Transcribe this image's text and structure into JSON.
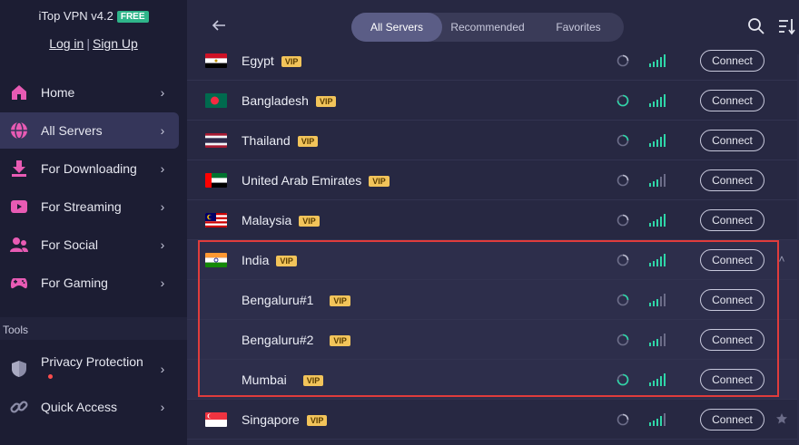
{
  "app": {
    "title": "iTop VPN v4.2",
    "badge": "FREE"
  },
  "auth": {
    "login": "Log in",
    "separator": "|",
    "signup": "Sign Up"
  },
  "sidebar": {
    "items": [
      {
        "label": "Home",
        "icon": "home-icon"
      },
      {
        "label": "All Servers",
        "icon": "globe-icon",
        "active": true
      },
      {
        "label": "For Downloading",
        "icon": "download-icon"
      },
      {
        "label": "For Streaming",
        "icon": "play-icon"
      },
      {
        "label": "For Social",
        "icon": "people-icon"
      },
      {
        "label": "For Gaming",
        "icon": "gamepad-icon"
      }
    ],
    "tools_label": "Tools",
    "tools": [
      {
        "label": "Privacy Protection",
        "icon": "shield-icon",
        "dot": true
      },
      {
        "label": "Quick Access",
        "icon": "link-icon"
      }
    ]
  },
  "tabs": [
    {
      "label": "All Servers",
      "active": true
    },
    {
      "label": "Recommended"
    },
    {
      "label": "Favorites"
    }
  ],
  "servers": [
    {
      "name": "Egypt",
      "vip": "VIP",
      "connect": "Connect",
      "signal": 5
    },
    {
      "name": "Bangladesh",
      "vip": "VIP",
      "connect": "Connect",
      "signal": 5
    },
    {
      "name": "Thailand",
      "vip": "VIP",
      "connect": "Connect",
      "signal": 5
    },
    {
      "name": "United Arab Emirates",
      "vip": "VIP",
      "connect": "Connect",
      "signal": 3
    },
    {
      "name": "Malaysia",
      "vip": "VIP",
      "connect": "Connect",
      "signal": 5
    },
    {
      "name": "India",
      "vip": "VIP",
      "connect": "Connect",
      "signal": 5
    },
    {
      "name": "Bengaluru#1",
      "vip": "VIP",
      "connect": "Connect",
      "signal": 3
    },
    {
      "name": "Bengaluru#2",
      "vip": "VIP",
      "connect": "Connect",
      "signal": 3
    },
    {
      "name": "Mumbai",
      "vip": "VIP",
      "connect": "Connect",
      "signal": 5
    },
    {
      "name": "Singapore",
      "vip": "VIP",
      "connect": "Connect",
      "signal": 4
    }
  ],
  "colors": {
    "accent": "#2fd6a8",
    "vip": "#f2c45a",
    "highlight_border": "#e03c3c"
  }
}
